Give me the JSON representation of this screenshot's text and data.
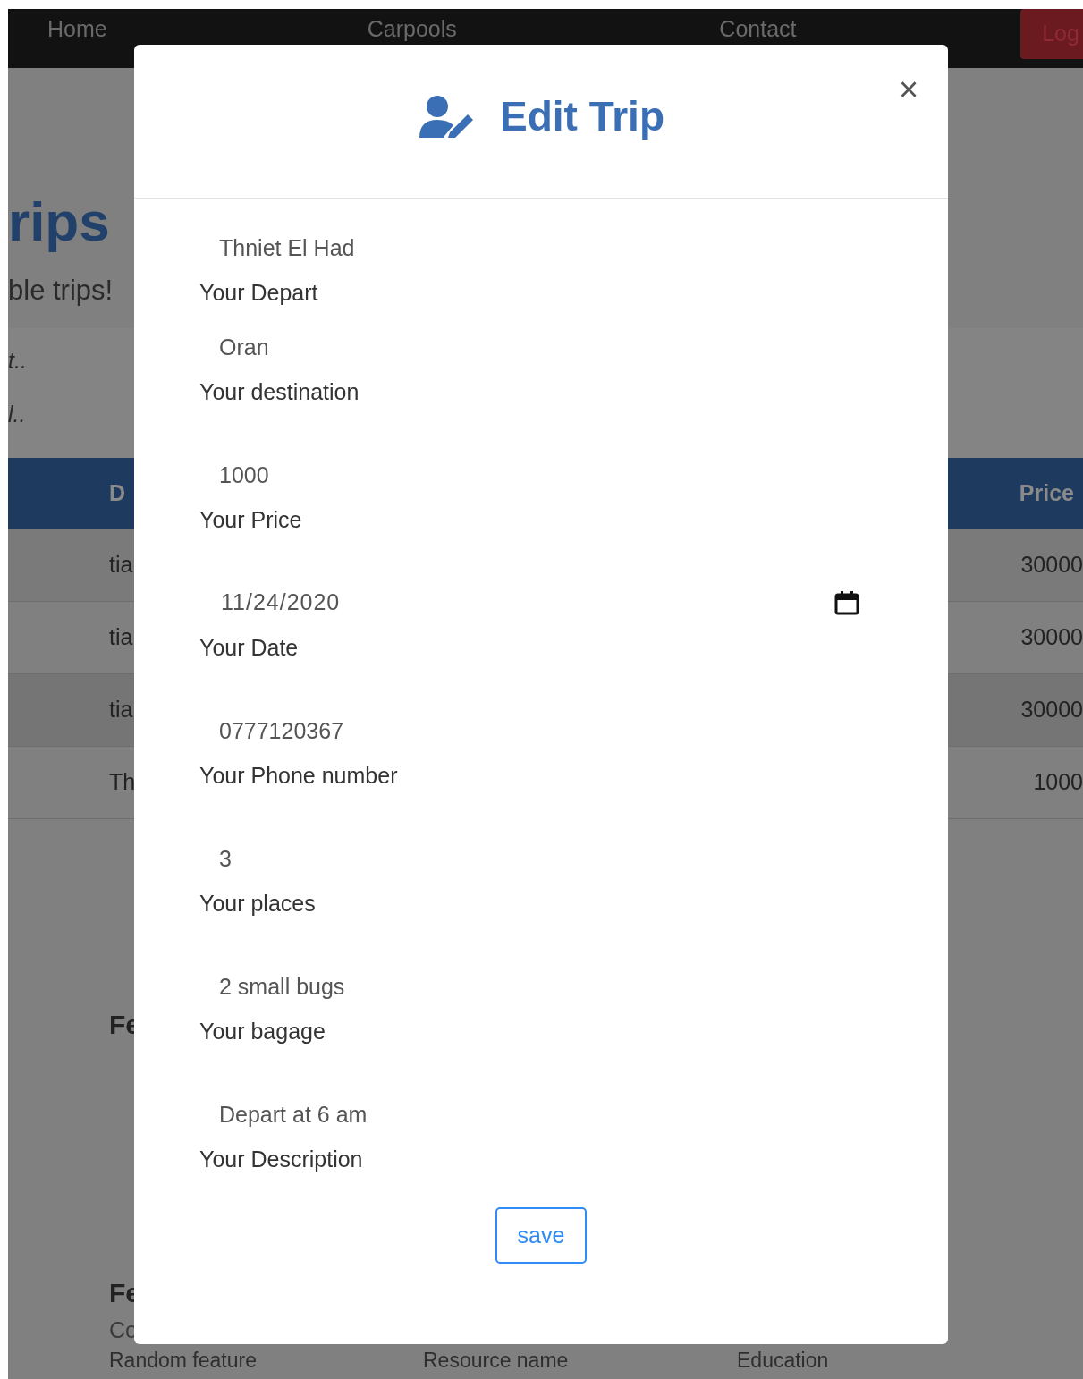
{
  "navbar": {
    "items": [
      {
        "label": "Home"
      },
      {
        "label": "Carpools"
      },
      {
        "label": "Contact"
      }
    ],
    "login_button": "Log"
  },
  "page": {
    "heading": "rips",
    "subheading": "ble trips!",
    "filter_lines": [
      "t..",
      "l.."
    ],
    "table": {
      "columns": [
        "D",
        "Price"
      ],
      "rows": [
        {
          "column_1": "tia",
          "price": "30000"
        },
        {
          "column_1": "tia",
          "price": "30000"
        },
        {
          "column_1": "tia",
          "price": "30000"
        },
        {
          "column_1": "Th",
          "price": "1000"
        }
      ]
    },
    "section_headings": [
      "Fe",
      "Fe"
    ],
    "section_text": "Co",
    "footer_row": [
      "Random feature",
      "Resource name",
      "Education"
    ]
  },
  "modal": {
    "title": "Edit Trip",
    "close": "×",
    "fields": [
      {
        "kind": "text",
        "value": "Thniet El Had",
        "label": "Your Depart"
      },
      {
        "kind": "text",
        "value": "Oran",
        "label": "Your destination"
      },
      {
        "kind": "text",
        "value": "1000",
        "label": "Your Price"
      },
      {
        "kind": "date",
        "value": "11/24/2020",
        "label": "Your Date"
      },
      {
        "kind": "text",
        "value": "0777120367",
        "label": "Your Phone number"
      },
      {
        "kind": "text",
        "value": "3",
        "label": "Your places"
      },
      {
        "kind": "text",
        "value": "2 small bugs",
        "label": "Your bagage"
      },
      {
        "kind": "text",
        "value": "Depart at 6 am",
        "label": "Your Description"
      }
    ],
    "save_button": "save"
  }
}
